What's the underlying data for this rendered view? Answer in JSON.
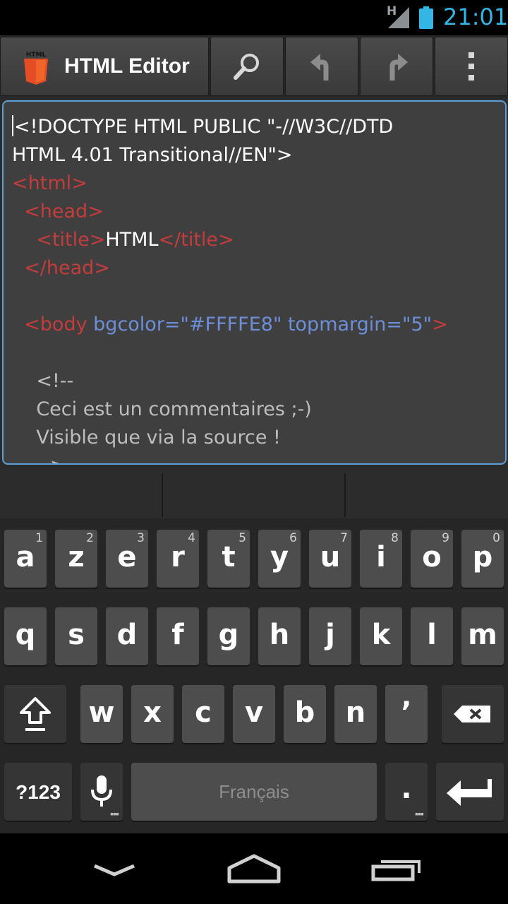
{
  "status_bar": {
    "network_label": "H",
    "time": "21:01",
    "accent_color": "#33b5e5"
  },
  "action_bar": {
    "title": "HTML Editor",
    "app_icon_label": "HTML",
    "icons": [
      "search-icon",
      "undo-icon",
      "redo-icon",
      "overflow-menu-icon"
    ]
  },
  "editor": {
    "lines": [
      [
        {
          "t": "txt",
          "v": "<!DOCTYPE HTML PUBLIC \"-//W3C//DTD"
        }
      ],
      [
        {
          "t": "txt",
          "v": "HTML 4.01 Transitional//EN\">"
        }
      ],
      [
        {
          "t": "tag",
          "v": "<html>"
        }
      ],
      [
        {
          "t": "tag",
          "v": "  <head>"
        }
      ],
      [
        {
          "t": "tag",
          "v": "    <title>"
        },
        {
          "t": "txt",
          "v": "HTML"
        },
        {
          "t": "tag",
          "v": "</title>"
        }
      ],
      [
        {
          "t": "tag",
          "v": "  </head>"
        }
      ],
      [
        {
          "t": "txt",
          "v": ""
        }
      ],
      [
        {
          "t": "tag",
          "v": "  <body"
        },
        {
          "t": "attr",
          "v": " bgcolor=\"#FFFFE8\" topmargin=\"5\""
        },
        {
          "t": "tag",
          "v": ">"
        }
      ],
      [
        {
          "t": "txt",
          "v": ""
        }
      ],
      [
        {
          "t": "cmt",
          "v": "    <!--"
        }
      ],
      [
        {
          "t": "cmt",
          "v": "    Ceci est un commentaires ;-)"
        }
      ],
      [
        {
          "t": "cmt",
          "v": "    Visible que via la source !"
        }
      ],
      [
        {
          "t": "cmt",
          "v": "    -->"
        }
      ]
    ],
    "colors": {
      "tag": "#c43c3c",
      "attr": "#6d8ed8",
      "text": "#ffffff",
      "comment": "#bdbdbd"
    }
  },
  "keyboard": {
    "row1": [
      {
        "k": "a",
        "h": "1"
      },
      {
        "k": "z",
        "h": "2"
      },
      {
        "k": "e",
        "h": "3"
      },
      {
        "k": "r",
        "h": "4"
      },
      {
        "k": "t",
        "h": "5"
      },
      {
        "k": "y",
        "h": "6"
      },
      {
        "k": "u",
        "h": "7"
      },
      {
        "k": "i",
        "h": "8"
      },
      {
        "k": "o",
        "h": "9"
      },
      {
        "k": "p",
        "h": "0"
      }
    ],
    "row2": [
      "q",
      "s",
      "d",
      "f",
      "g",
      "h",
      "j",
      "k",
      "l",
      "m"
    ],
    "row3": [
      "w",
      "x",
      "c",
      "v",
      "b",
      "n",
      "’"
    ],
    "symbols_label": "?123",
    "space_label": "Français",
    "period_label": "."
  },
  "nav_bar": {
    "icons": [
      "back-icon",
      "home-icon",
      "recent-apps-icon"
    ]
  }
}
